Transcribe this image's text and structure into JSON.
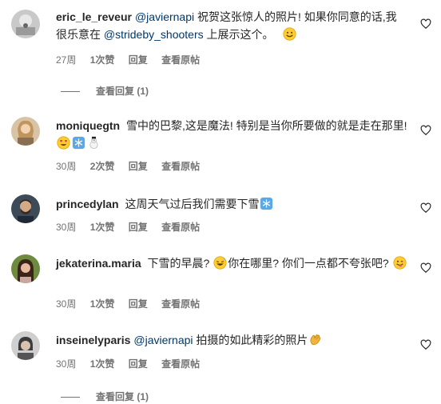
{
  "comments": [
    {
      "username": "eric_le_reveur",
      "mention": "@javiernapi",
      "text_a": " 祝贺这张惊人的照片! 如果你同意的话,我很乐意在 ",
      "mention2": "@strideby_shooters",
      "text_b": " 上展示这个。",
      "time": "27周",
      "likes": "1次赞",
      "reply": "回复",
      "translate": "查看原帖",
      "view_replies": "查看回复 (1)"
    },
    {
      "username": "moniquegtn",
      "text": " 雪中的巴黎,这是魔法! 特别是当你所要做的就是走在那里!",
      "time": "30周",
      "likes": "2次赞",
      "reply": "回复",
      "translate": "查看原帖"
    },
    {
      "username": "princedylan",
      "text": " 这周天气过后我们需要下雪",
      "time": "30周",
      "likes": "1次赞",
      "reply": "回复",
      "translate": "查看原帖"
    },
    {
      "username": "jekaterina.maria",
      "text_a": " 下雪的早晨?",
      "text_b": "你在哪里? 你们一点都不夸张吧?",
      "time": "30周",
      "likes": "1次赞",
      "reply": "回复",
      "translate": "查看原帖"
    },
    {
      "username": "inseinelyparis",
      "mention": "@javiernapi",
      "text": " 拍摄的如此精彩的照片",
      "time": "30周",
      "likes": "1次赞",
      "reply": "回复",
      "translate": "查看原帖",
      "view_replies": "查看回复 (1)"
    }
  ],
  "icons": {
    "like": "heart-outline-icon",
    "smile": "smiling-face-emoji",
    "heart_eyes": "heart-eyes-emoji",
    "snowflake": "snowflake-emoji",
    "snowman": "snowman-emoji",
    "laugh": "grinning-sweat-emoji",
    "wink": "winking-tongue-emoji",
    "clap": "clapping-hands-emoji"
  },
  "colors": {
    "text": "#262626",
    "secondary": "#737373",
    "mention": "#00376b"
  }
}
